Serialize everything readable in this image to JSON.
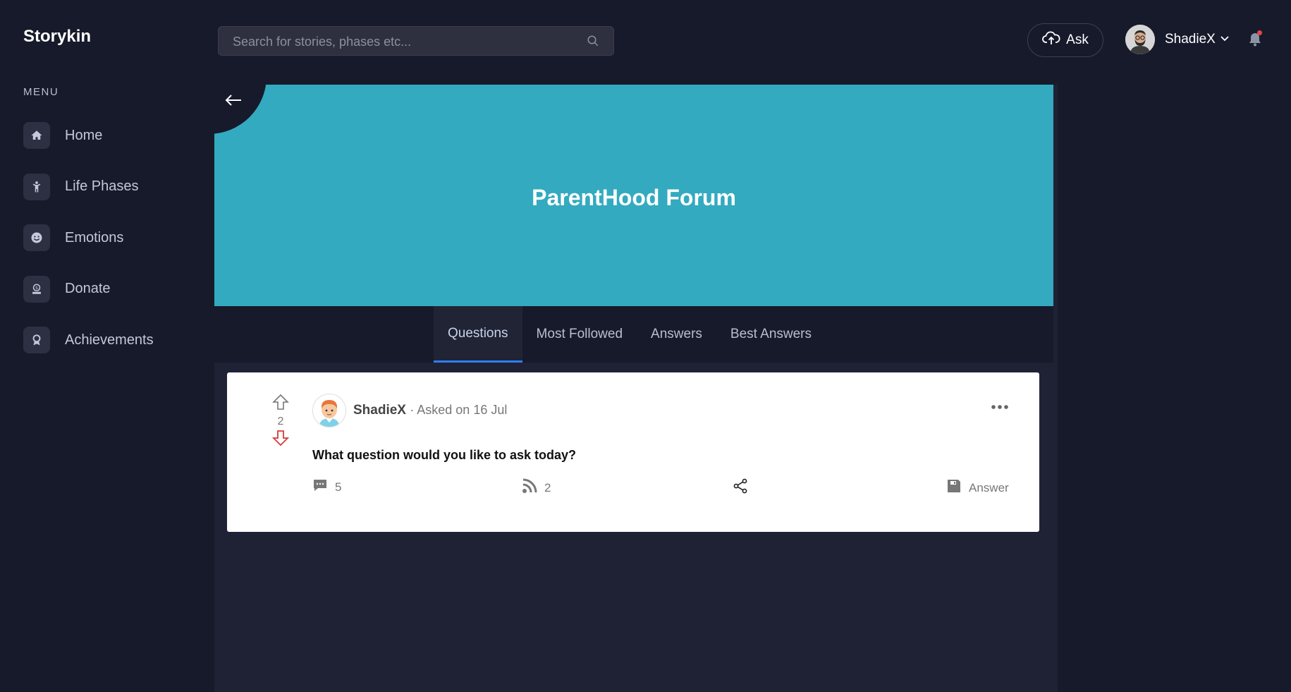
{
  "app": {
    "name": "Storykin"
  },
  "sidebar": {
    "menu_title": "MENU",
    "items": [
      {
        "label": "Home",
        "icon": "home-icon"
      },
      {
        "label": "Life Phases",
        "icon": "person-icon"
      },
      {
        "label": "Emotions",
        "icon": "smiley-icon"
      },
      {
        "label": "Donate",
        "icon": "donate-icon"
      },
      {
        "label": "Achievements",
        "icon": "award-icon"
      }
    ]
  },
  "header": {
    "search_placeholder": "Search for stories, phases etc...",
    "ask_label": "Ask",
    "user_name": "ShadieX"
  },
  "forum": {
    "title": "ParentHood Forum",
    "tabs": [
      "Questions",
      "Most Followed",
      "Answers",
      "Best Answers"
    ],
    "active_tab": "Questions"
  },
  "question": {
    "votes": "2",
    "author": "ShadieX",
    "date": "· Asked on 16 Jul",
    "title": "What question would you like to ask today?",
    "comments": "5",
    "followers": "2",
    "answer_label": "Answer"
  },
  "colors": {
    "background": "#161a2b",
    "banner": "#33aabf",
    "tab_active_underline": "#2d7ff9",
    "notification_dot": "#e64545",
    "downvote": "#d63a3a"
  }
}
